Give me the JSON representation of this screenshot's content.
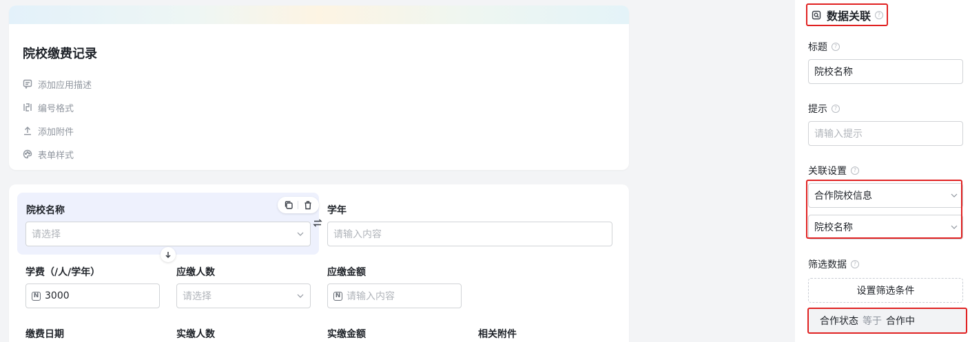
{
  "app": {
    "title": "院校缴费记录",
    "menu": [
      {
        "icon": "comment-icon",
        "label": "添加应用描述"
      },
      {
        "icon": "numbering-icon",
        "label": "编号格式"
      },
      {
        "icon": "upload-icon",
        "label": "添加附件"
      },
      {
        "icon": "palette-icon",
        "label": "表单样式"
      }
    ]
  },
  "form": {
    "school": {
      "label": "院校名称",
      "placeholder": "请选择"
    },
    "year": {
      "label": "学年",
      "placeholder": "请输入内容"
    },
    "tuition": {
      "label": "学费（/人/学年）",
      "value": "3000",
      "badge": "N"
    },
    "payable_count": {
      "label": "应缴人数",
      "placeholder": "请选择"
    },
    "payable_amount": {
      "label": "应缴金额",
      "placeholder": "请输入内容",
      "badge": "N"
    },
    "pay_date": {
      "label": "缴费日期"
    },
    "paid_count": {
      "label": "实缴人数"
    },
    "paid_amount": {
      "label": "实缴金额"
    },
    "attachments": {
      "label": "相关附件"
    }
  },
  "panel": {
    "title": "数据关联",
    "title_label": "标题",
    "title_value": "院校名称",
    "hint_label": "提示",
    "hint_placeholder": "请输入提示",
    "relation_label": "关联设置",
    "relation_form": "合作院校信息",
    "relation_field": "院校名称",
    "filter_label": "筛选数据",
    "filter_button": "设置筛选条件",
    "condition": {
      "field": "合作状态",
      "operator": "等于",
      "value": "合作中"
    },
    "help_glyph": "?"
  },
  "colors": {
    "highlight_border": "#e02020",
    "selected_field_bg": "#eef1fd"
  }
}
